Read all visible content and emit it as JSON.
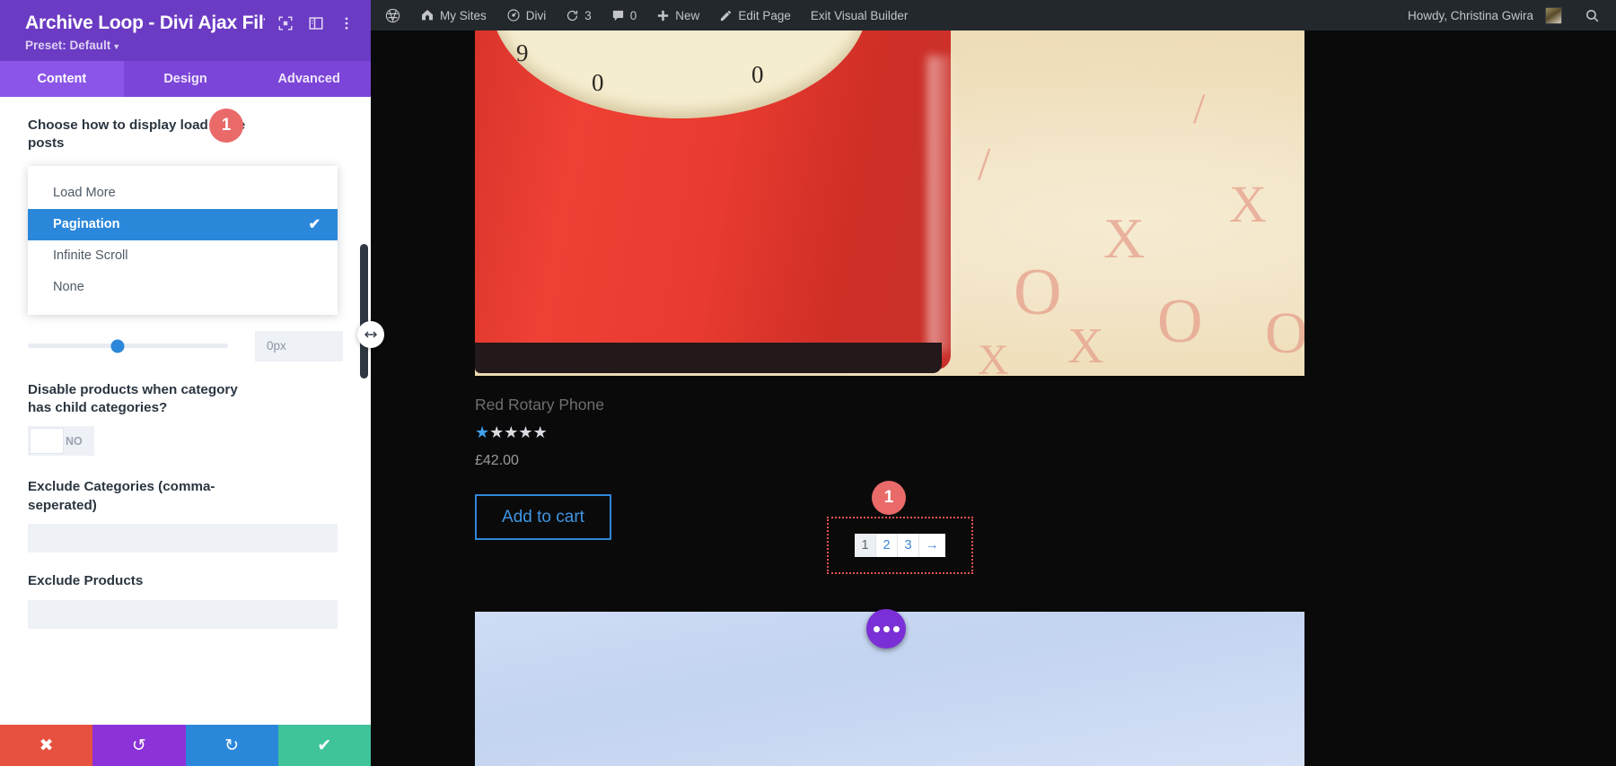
{
  "module_panel": {
    "title": "Archive Loop - Divi Ajax Filt...",
    "preset": "Preset: Default",
    "icons": {
      "fullscreen": "expand-module-icon",
      "layout": "panel-layout-icon",
      "more": "vertical-dots-icon"
    },
    "tabs": [
      {
        "label": "Content",
        "active": true
      },
      {
        "label": "Design",
        "active": false
      },
      {
        "label": "Advanced",
        "active": false
      }
    ],
    "fields": {
      "display_mode": {
        "label": "Choose how to display load more posts",
        "badge": "1",
        "options": [
          {
            "label": "Load More",
            "selected": false
          },
          {
            "label": "Pagination",
            "selected": true
          },
          {
            "label": "Infinite Scroll",
            "selected": false
          },
          {
            "label": "None",
            "selected": false
          }
        ],
        "check_glyph": "✔"
      },
      "slider": {
        "value": "0px",
        "knob_percent": 45
      },
      "disable_child": {
        "label": "Disable products when category has child categories?",
        "toggle_state": "NO"
      },
      "exclude_categories": {
        "label": "Exclude Categories (comma-seperated)",
        "value": "",
        "placeholder": ""
      },
      "exclude_products": {
        "label": "Exclude Products",
        "value": "",
        "placeholder": ""
      }
    },
    "footer": {
      "discard": "✖",
      "undo": "↺",
      "redo": "↻",
      "save": "✔"
    }
  },
  "adminbar": {
    "items": [
      {
        "icon": "wordpress-logo-icon",
        "label": ""
      },
      {
        "icon": "my-sites-icon",
        "label": "My Sites"
      },
      {
        "icon": "divi-icon",
        "label": "Divi"
      },
      {
        "icon": "updates-icon",
        "label": "3"
      },
      {
        "icon": "comments-icon",
        "label": "0"
      },
      {
        "icon": "plus-icon",
        "label": "New"
      },
      {
        "icon": "pencil-icon",
        "label": "Edit Page"
      },
      {
        "icon": "",
        "label": "Exit Visual Builder"
      }
    ],
    "howdy": "Howdy, Christina Gwira",
    "search_icon": "search-icon"
  },
  "canvas": {
    "product": {
      "title": "Red Rotary Phone",
      "rating": 1,
      "rating_max": 5,
      "price": "£42.00",
      "add_to_cart": "Add to cart",
      "image_alt": "red rotary telephone on patterned paper"
    },
    "pagination": {
      "badge": "1",
      "items": [
        {
          "label": "1",
          "current": true
        },
        {
          "label": "2",
          "current": false
        },
        {
          "label": "3",
          "current": false
        },
        {
          "label": "→",
          "current": false
        }
      ]
    },
    "fab_more": "more-options-icon"
  },
  "colors": {
    "panel_header": "#6b3bc4",
    "tab_bar": "#7b45d8",
    "tab_active": "#8b55e8",
    "selected_blue": "#2b87da",
    "badge_red": "#ea6a6a",
    "adminbar_bg": "#23282d",
    "save_green": "#3fc39b",
    "discard_red": "#e7513f",
    "undo_purple": "#8b32d8",
    "pagination_border": "#e0544f"
  }
}
